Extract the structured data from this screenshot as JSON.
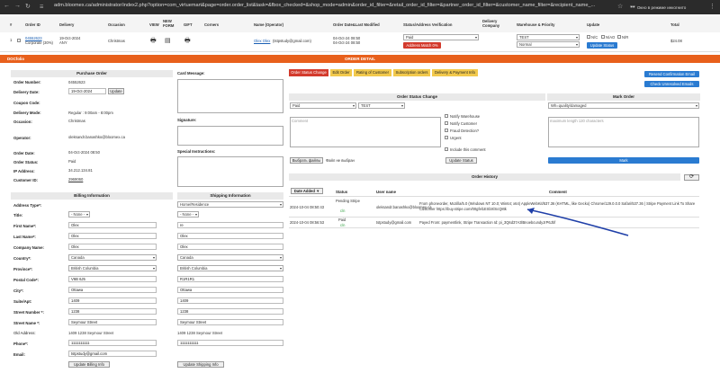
{
  "browser": {
    "url": "adm.bloomex.ca/administrator/index2.php?option=com_virtuemart&page=order.order_list&task=&fbox_checked=&shop_mode=admin&order_id_filter=&retail_order_id_filter=&partner_order_id_filter=&customer_name_filter=&recipient_name_...",
    "incognito_label": "Окно в режиме инкогнито"
  },
  "header": {
    "cols": [
      "#",
      "Order ID",
      "Delivery",
      "Occasion",
      "VIEW",
      "NEW FORM",
      "GIFT",
      "Corners",
      "Name (Operator)",
      "Order Date&Last Modified",
      "Status/Address Verification",
      "Delivery Company",
      "Warehouse & Priority",
      "Update",
      "Total"
    ]
  },
  "order_row": {
    "num": "1",
    "order_id": "04552623",
    "order_sub": "Corporate (30%)",
    "delivery_date": "19-Oct-2024",
    "delivery_sub": "ANY",
    "occasion": "Christmas",
    "name": "Olex Olex",
    "name_email": "(tstpstudy@gmail.com)",
    "order_date": "04-Oct-24 08:50",
    "modified_date": "04-Oct-24 08:50",
    "status": "Paid",
    "address_match": "Address Match 0%",
    "warehouse": "TEST",
    "priority": "Normal",
    "nc": "N/C",
    "nao": "N/AO",
    "nr": "N/R",
    "update": "Update Status",
    "total": "$24.08"
  },
  "orange_bar": {
    "left": "DOCfolio",
    "title": "ORDER DETAIL"
  },
  "purchase": {
    "title": "Purchase Order",
    "order_number_label": "Order Number:",
    "order_number": "04552623",
    "delivery_date_label": "Delivery Date:",
    "delivery_date": "19-Oct-2024",
    "update": "Update",
    "coupon_label": "Coupon Code:",
    "delivery_mode_label": "Delivery Mode:",
    "delivery_mode": "Regular : 9:00am - 8:00pm",
    "occasion_label": "Occasion:",
    "occasion": "Christmas",
    "operator_label": "Operator:",
    "operator": "oleksandr.banashko@bloomex.ca",
    "order_date_label": "Order Date:",
    "order_date": "04-Oct-2024 08:50",
    "order_status_label": "Order Status:",
    "order_status": "Paid",
    "ip_label": "IP Address:",
    "ip": "34.212.134.81",
    "customer_id_label": "Customer ID:",
    "customer_id": "2969060"
  },
  "card_message": "Card Message:",
  "signature": "Signature:",
  "special": "Special Instructions:",
  "tabs": [
    "Order Status Change",
    "Edit Order",
    "Rating of Customer",
    "Subscription orders",
    "Delivery & Payment Info"
  ],
  "right_buttons": {
    "resend": "Resend Confirmation Email",
    "check": "Check Unresolved Emails"
  },
  "status_change": {
    "title": "Order Status Change",
    "status": "Paid",
    "warehouse": "TEST",
    "comment_placeholder": "Comment",
    "notify_warehouse": "Notify Warehouse",
    "notify_customer": "Notify Customer",
    "fraud": "Fraud Detection?",
    "urgent": "Urgent",
    "include": "Include this comment",
    "choose_file": "Выбрать файлы",
    "no_file": "Файл не выбран",
    "update": "Update Status"
  },
  "mark_order": {
    "title": "Mark Order",
    "option": "Wh=quality/damaged",
    "placeholder": "maximum length 120 characters",
    "button": "Mark"
  },
  "history": {
    "title": "Order History",
    "cols": [
      "Date Added",
      "Status",
      "User name",
      "Comment"
    ],
    "rows": [
      {
        "date": "2024-10-04 08:50:43",
        "status": "Pending Stripe",
        "status_sub": "c/n",
        "user": "oleksandr.banashko@bloomex.ca",
        "comment": "From phoneorder, Mozilla/5.0 (Windows NT 10.0; Win64; x64) AppleWebKit/537.36 (KHTML, like Gecko) Chrome/129.0.0.0 Safari/537.36 | Stripe Payment Link To Share Customer https://buy.stripe.com/00gfel1ESbXlScQ8tk"
      },
      {
        "date": "2024-10-04 08:56:53",
        "status": "Paid",
        "status_sub": "c/n",
        "user": "tstpstudy@gmail.com",
        "comment": "Payed From: paymentlink, Stripe Transaction Id: pi_3Q6d37A3lBnoebcundyJrP6Jbf"
      }
    ]
  },
  "billing": {
    "title": "Billing Information",
    "shipping_title": "Shipping Information",
    "address_type_label": "Address Type*:",
    "shipping_address_type": "Home/Residence",
    "title_label": "Title:",
    "title_val": "- None -",
    "first_name_label": "First Name*:",
    "first_name": "Olex",
    "shipping_first_name": "re",
    "last_name_label": "Last Name*:",
    "last_name": "Olex",
    "shipping_last_name": "Olex",
    "company_label": "Company Name:",
    "company": "Olex",
    "shipping_company": "Olex",
    "country_label": "Country*:",
    "country": "Canada",
    "province_label": "Province*:",
    "province": "British Columbia",
    "postal_label": "Postal Code*:",
    "postal": "V6B 6J5",
    "shipping_postal": "R1R1R1",
    "city_label": "City*:",
    "city": "Ottawa",
    "suite_label": "Suite/Apt:",
    "suite": "1409",
    "street_number_label": "Street Number *:",
    "street_number": "1238",
    "street_name_label": "Street Name *:",
    "street_name": "Seymour Street",
    "old_address_label": "Old Address:",
    "old_address": "1409 1238 Seymour Street",
    "phone_label": "Phone*:",
    "phone": "1111111111",
    "email_label": "Email:",
    "email": "tstpstudy@gmail.com",
    "update_billing": "Update Billing Info",
    "update_shipping": "Update Shipping Info"
  },
  "colors": {
    "orange": "#e8601c",
    "red": "#d33a2c",
    "blue": "#2a7bd1",
    "tab_yellow": "#f2c94c"
  }
}
